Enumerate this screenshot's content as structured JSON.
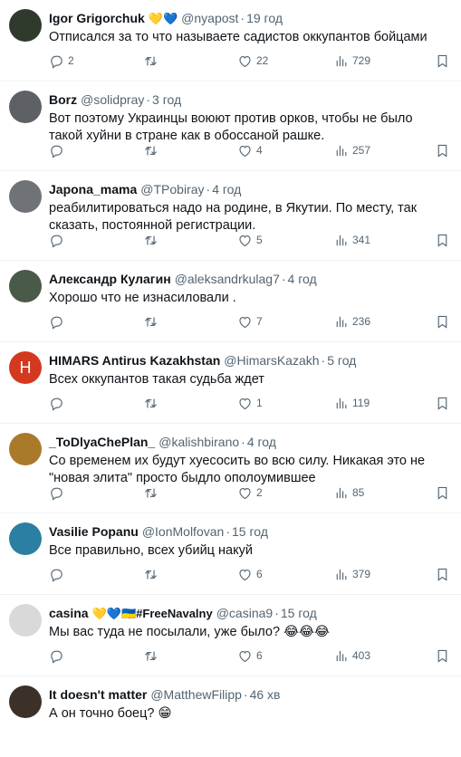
{
  "tweets": [
    {
      "name": "Igor Grigorchuk",
      "name_suffix": "💛💙",
      "handle": "@nyapost",
      "time": "19 год",
      "text": "Отписался за то что называете садистов оккупантов бойцами",
      "replies": "2",
      "retweets": "",
      "likes": "22",
      "views": "729",
      "avatar_color": "#2f3a2c",
      "avatar_letter": ""
    },
    {
      "name": "Borz",
      "name_suffix": "",
      "handle": "@solidpray",
      "time": "3 год",
      "text": "Вот поэтому Украинцы воюют против орков, чтобы не было такой хуйни в стране как в обоссаной рашке.",
      "replies": "",
      "retweets": "",
      "likes": "4",
      "views": "257",
      "avatar_color": "#5d6165",
      "avatar_letter": ""
    },
    {
      "name": "Japona_mama",
      "name_suffix": "",
      "handle": "@TPobiray",
      "time": "4 год",
      "text": "реабилитироваться надо на родине, в Якутии. По месту, так сказать, постоянной регистрации.",
      "replies": "",
      "retweets": "",
      "likes": "5",
      "views": "341",
      "avatar_color": "#6f7377",
      "avatar_letter": ""
    },
    {
      "name": "Александр Кулагин",
      "name_suffix": "",
      "handle": "@aleksandrkulag7",
      "time": "4 год",
      "text": "Хорошо что не изнасиловали .",
      "replies": "",
      "retweets": "",
      "likes": "7",
      "views": "236",
      "avatar_color": "#4a5a48",
      "avatar_letter": ""
    },
    {
      "name": "HIMARS Antirus Kazakhstan",
      "name_suffix": "",
      "handle": "@HimarsKazakh",
      "time": "5 год",
      "text": "Всех оккупантов такая судьба ждет",
      "replies": "",
      "retweets": "",
      "likes": "1",
      "views": "119",
      "avatar_color": "#d3391f",
      "avatar_letter": "H"
    },
    {
      "name": "_ToDlyaChePlan_",
      "name_suffix": "",
      "handle": "@kalishbirano",
      "time": "4 год",
      "text": "Со временем их будут хуесосить во всю силу. Никакая это не \"новая элита\" просто быдло ополоумившее",
      "replies": "",
      "retweets": "",
      "likes": "2",
      "views": "85",
      "avatar_color": "#a87a2a",
      "avatar_letter": ""
    },
    {
      "name": "Vasilie Popanu",
      "name_suffix": "",
      "handle": "@IonMolfovan",
      "time": "15 год",
      "text": "Все правильно, всех убийц накуй",
      "replies": "",
      "retweets": "",
      "likes": "6",
      "views": "379",
      "avatar_color": "#2b7fa0",
      "avatar_letter": ""
    },
    {
      "name": "casina",
      "name_suffix": "💛💙🇺🇦#FreeNavalny",
      "handle": "@casina9",
      "time": "15 год",
      "text": "Мы вас туда не посылали, уже было? 😂😂😂",
      "replies": "",
      "retweets": "",
      "likes": "6",
      "views": "403",
      "avatar_color": "#d9d9d9",
      "avatar_letter": ""
    },
    {
      "name": "It doesn't matter",
      "name_suffix": "",
      "handle": "@MatthewFilipp",
      "time": "46 хв",
      "text": "А он точно боец? 😁",
      "replies": "",
      "retweets": "",
      "likes": "",
      "views": "",
      "avatar_color": "#3b3128",
      "avatar_letter": ""
    }
  ],
  "icons": {
    "reply": "reply-icon",
    "retweet": "retweet-icon",
    "like": "heart-icon",
    "views": "views-icon",
    "bookmark": "bookmark-icon"
  },
  "colors": {
    "text": "#0f1419",
    "muted": "#536471",
    "divider": "#eff3f4"
  }
}
